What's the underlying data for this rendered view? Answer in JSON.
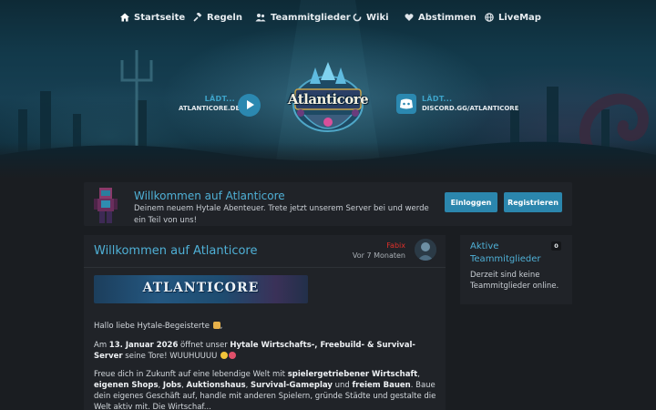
{
  "nav": {
    "items": [
      {
        "label": "Startseite",
        "icon": "home-icon"
      },
      {
        "label": "Regeln",
        "icon": "gavel-icon"
      },
      {
        "label": "Teammitglieder",
        "icon": "users-icon"
      },
      {
        "label": "Wiki",
        "icon": "spinner-icon"
      },
      {
        "label": "Abstimmen",
        "icon": "heart-icon"
      },
      {
        "label": "LiveMap",
        "icon": "globe-icon"
      }
    ]
  },
  "hero": {
    "logo_text": "Atlanticore",
    "server_status": {
      "label": "LÄDT...",
      "address": "ATLANTICORE.DE",
      "icon": "play-icon"
    },
    "discord_status": {
      "label": "LÄDT...",
      "address": "DISCORD.GG/ATLANTICORE",
      "icon": "discord-icon"
    }
  },
  "welcome": {
    "title": "Willkommen auf Atlanticore",
    "subtitle": "Deinem neuem Hytale Abenteuer. Trete jetzt unserem Server bei und werde ein Teil von uns!",
    "login_label": "Einloggen",
    "register_label": "Registrieren"
  },
  "post": {
    "title": "Willkommen auf Atlanticore",
    "author": "Fabix",
    "time": "Vor 7 Monaten",
    "banner_text": "ATLANTICORE",
    "greeting": "Hallo liebe Hytale-Begeisterte",
    "p2_a": "Am ",
    "p2_date": "13. Januar 2026",
    "p2_b": " öffnet unser ",
    "p2_modes": "Hytale Wirtschafts-, Freebuild- & Survival-Server",
    "p2_c": " seine Tore! WUUHUUUU",
    "p3_a": "Freue dich in Zukunft auf eine lebendige Welt mit ",
    "p3_b1": "spielergetriebener Wirtschaft",
    "p3_sep1": ", ",
    "p3_b2": "eigenen Shops",
    "p3_sep2": ", ",
    "p3_b3": "Jobs",
    "p3_sep3": ", ",
    "p3_b4": "Auktionshaus",
    "p3_sep4": ", ",
    "p3_b5": "Survival-Gameplay",
    "p3_sep5": " und ",
    "p3_b6": "freiem Bauen",
    "p3_c": ". Baue dein eigenes Geschäft auf, handle mit anderen Spielern, gründe Städte und gestalte die Welt aktiv mit. Die Wirtschaf..."
  },
  "sidebar": {
    "title": "Aktive Teammitglieder",
    "count": "0",
    "empty_text": "Derzeit sind keine Teammitglieder online."
  },
  "colors": {
    "accent": "#4fb0d6",
    "button": "#2b86ad",
    "author": "#e0302a",
    "panel": "#202328",
    "background": "#1a1d21"
  }
}
